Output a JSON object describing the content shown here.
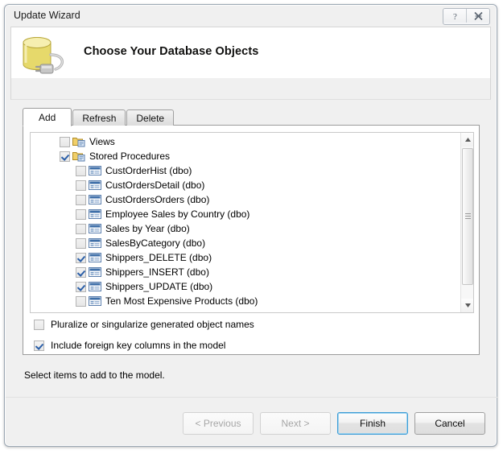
{
  "window": {
    "title": "Update Wizard",
    "help_button": "?",
    "close_button": "X"
  },
  "header": {
    "title": "Choose Your Database Objects",
    "icon": "database-connection-icon"
  },
  "tabs": [
    {
      "label": "Add",
      "selected": true
    },
    {
      "label": "Refresh",
      "selected": false
    },
    {
      "label": "Delete",
      "selected": false
    }
  ],
  "tree": {
    "nodes": [
      {
        "label": "Views",
        "checked": false,
        "level": 0,
        "icon": "folder-views-icon"
      },
      {
        "label": "Stored Procedures",
        "checked": true,
        "level": 0,
        "icon": "folder-procedures-icon"
      },
      {
        "label": "CustOrderHist (dbo)",
        "checked": false,
        "level": 1,
        "icon": "stored-procedure-icon"
      },
      {
        "label": "CustOrdersDetail (dbo)",
        "checked": false,
        "level": 1,
        "icon": "stored-procedure-icon"
      },
      {
        "label": "CustOrdersOrders (dbo)",
        "checked": false,
        "level": 1,
        "icon": "stored-procedure-icon"
      },
      {
        "label": "Employee Sales by Country (dbo)",
        "checked": false,
        "level": 1,
        "icon": "stored-procedure-icon"
      },
      {
        "label": "Sales by Year (dbo)",
        "checked": false,
        "level": 1,
        "icon": "stored-procedure-icon"
      },
      {
        "label": "SalesByCategory (dbo)",
        "checked": false,
        "level": 1,
        "icon": "stored-procedure-icon"
      },
      {
        "label": "Shippers_DELETE (dbo)",
        "checked": true,
        "level": 1,
        "icon": "stored-procedure-icon"
      },
      {
        "label": "Shippers_INSERT (dbo)",
        "checked": true,
        "level": 1,
        "icon": "stored-procedure-icon"
      },
      {
        "label": "Shippers_UPDATE (dbo)",
        "checked": true,
        "level": 1,
        "icon": "stored-procedure-icon"
      },
      {
        "label": "Ten Most Expensive Products (dbo)",
        "checked": false,
        "level": 1,
        "icon": "stored-procedure-icon"
      }
    ]
  },
  "options": [
    {
      "label": "Pluralize or singularize generated object names",
      "checked": false
    },
    {
      "label": "Include foreign key columns in the model",
      "checked": true
    }
  ],
  "status": "Select items to add to the model.",
  "footer_buttons": [
    {
      "label": "< Previous",
      "state": "disabled"
    },
    {
      "label": "Next >",
      "state": "disabled"
    },
    {
      "label": "Finish",
      "state": "default"
    },
    {
      "label": "Cancel",
      "state": "normal"
    }
  ],
  "colors": {
    "accent": "#3c9cd6",
    "window_bg": "#f0f0f0",
    "panel_bg": "#ffffff",
    "check_mark": "#2b5fa8",
    "db_icon_yellow": "#e8dc6a"
  }
}
